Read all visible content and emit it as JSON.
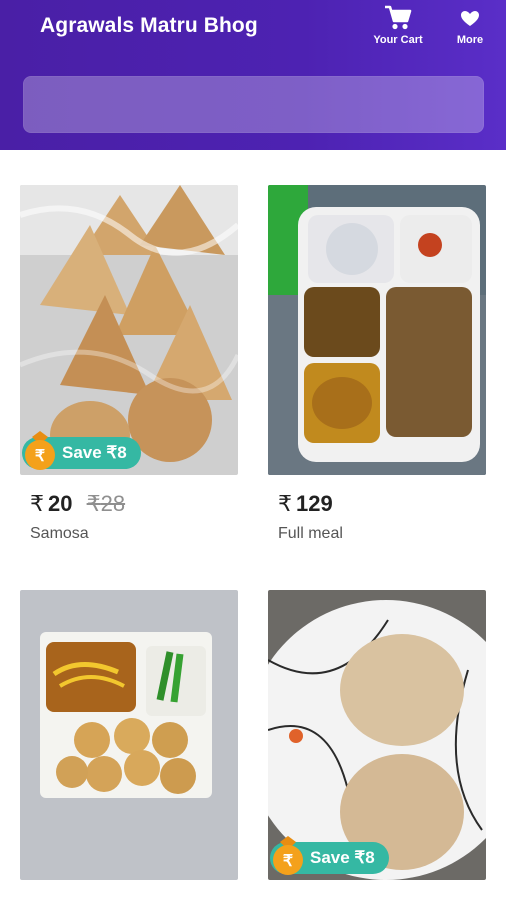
{
  "app": {
    "title": "Agrawals Matru Bhog"
  },
  "header": {
    "cart_label": "Your Cart",
    "more_label": "More"
  },
  "search": {
    "placeholder": ""
  },
  "products": [
    {
      "name": "Samosa",
      "currency": "₹",
      "price": "20",
      "mrp": "28",
      "save": "Save ₹8"
    },
    {
      "name": "Full meal",
      "currency": "₹",
      "price": "129",
      "mrp": "",
      "save": ""
    },
    {
      "name": "",
      "currency": "",
      "price": "",
      "mrp": "",
      "save": ""
    },
    {
      "name": "",
      "currency": "",
      "price": "",
      "mrp": "",
      "save": "Save ₹8"
    }
  ],
  "colors": {
    "header": "#4d22b2",
    "badge": "#35b8a3",
    "coin": "#f4a11b"
  },
  "icons": [
    "cart-icon",
    "heart-icon",
    "coin-icon"
  ]
}
